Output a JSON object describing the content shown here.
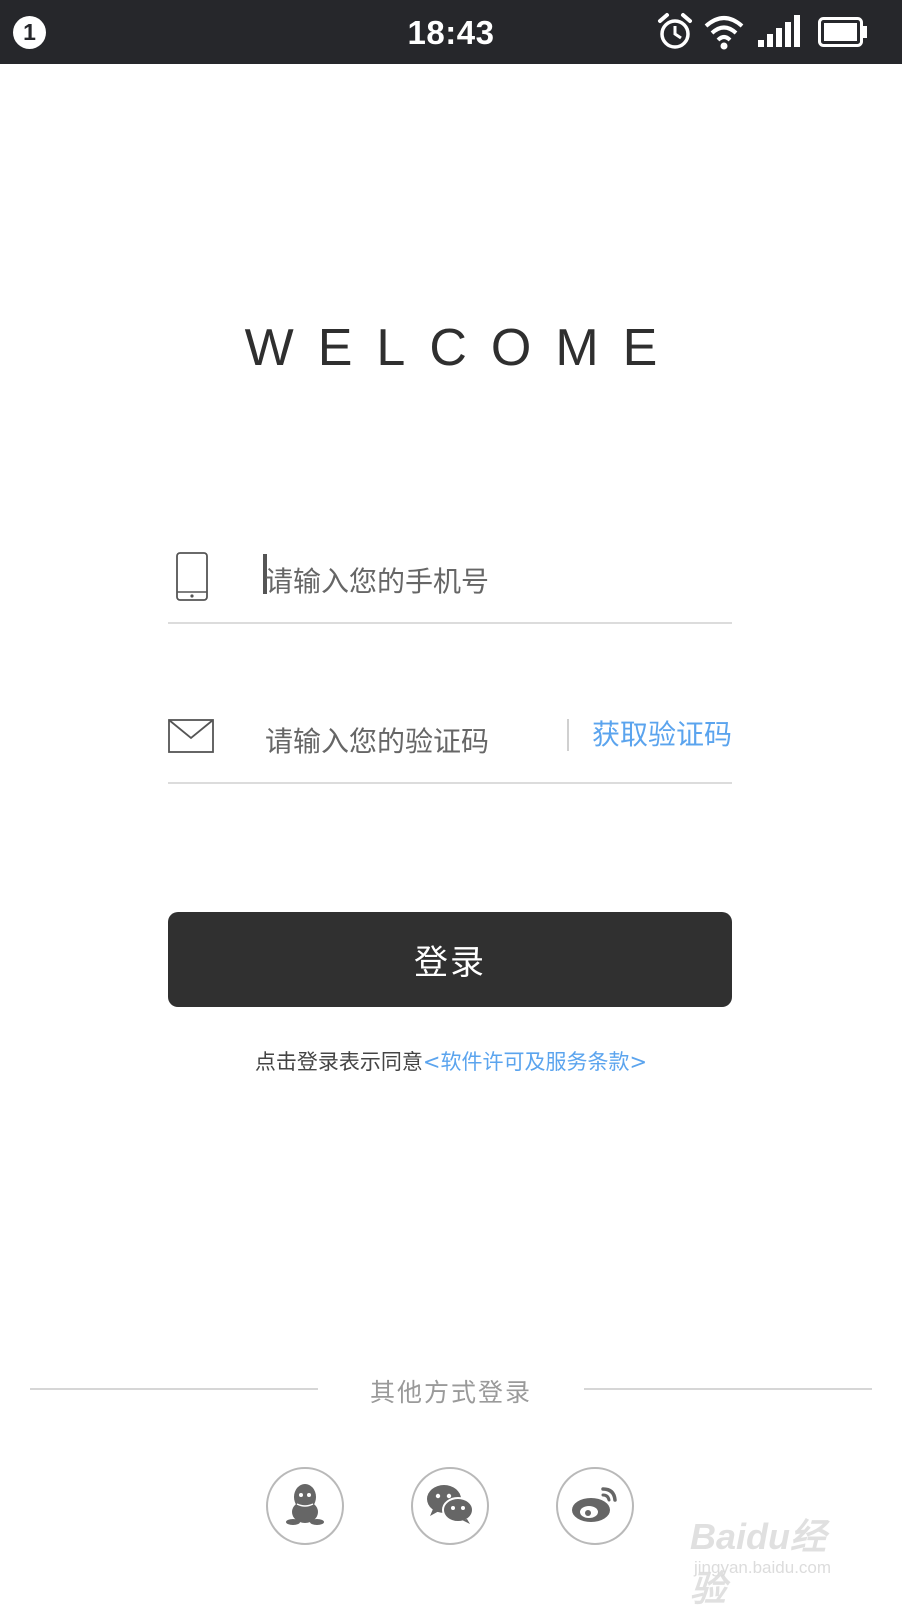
{
  "status_bar": {
    "notification_count": "1",
    "time": "18:43",
    "icons": [
      "alarm-icon",
      "wifi-icon",
      "signal-icon",
      "battery-icon"
    ]
  },
  "welcome_title": "WELCOME",
  "phone_field": {
    "placeholder": "请输入您的手机号",
    "value": "",
    "icon": "phone-icon"
  },
  "code_field": {
    "placeholder": "请输入您的验证码",
    "value": "",
    "icon": "mail-icon",
    "get_code_label": "获取验证码"
  },
  "login_button": {
    "label": "登录"
  },
  "agreement": {
    "prefix": "点击登录表示同意",
    "link_text": "<软件许可及服务条款>"
  },
  "other_login": {
    "label": "其他方式登录",
    "methods": [
      "qq-icon",
      "wechat-icon",
      "weibo-icon"
    ]
  },
  "watermark": {
    "brand": "Baidu经验",
    "sub": "jingyan.baidu.com"
  },
  "colors": {
    "status_bar_bg": "#26272b",
    "accent_link": "#5ba4ee",
    "button_bg": "#303030"
  }
}
